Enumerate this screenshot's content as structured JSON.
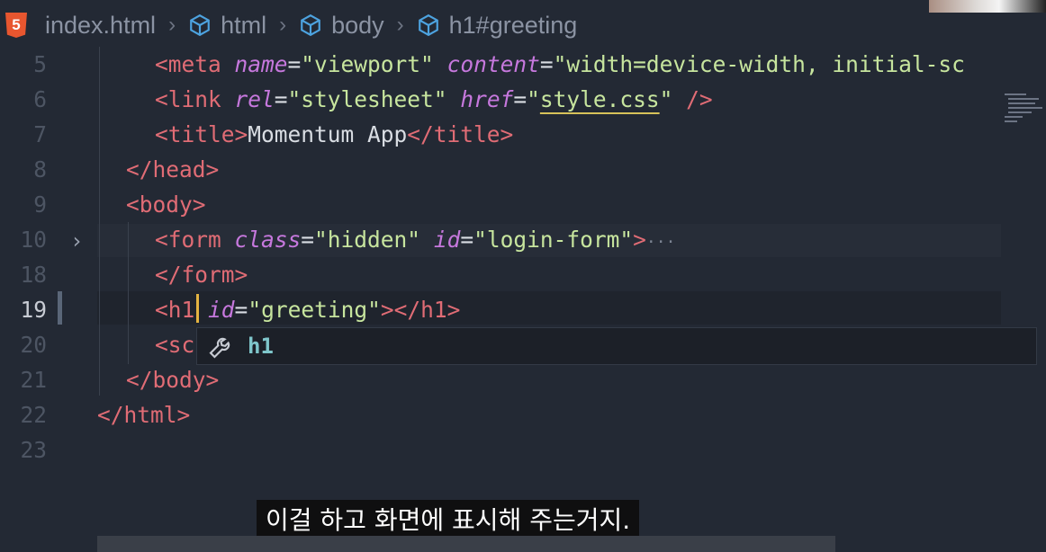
{
  "breadcrumb": {
    "file": "index.html",
    "items": [
      "html",
      "body",
      "h1#greeting"
    ],
    "file_icon_text": "5"
  },
  "lines": [
    {
      "num": "5",
      "code": [
        [
          "t",
          "<meta "
        ],
        [
          "a",
          "name"
        ],
        [
          "w",
          "="
        ],
        [
          "s",
          "\"viewport\""
        ],
        [
          "w",
          " "
        ],
        [
          "a",
          "content"
        ],
        [
          "w",
          "="
        ],
        [
          "s",
          "\"width=device-width, initial-sc"
        ]
      ]
    },
    {
      "num": "6",
      "code": [
        [
          "t",
          "<link "
        ],
        [
          "a",
          "rel"
        ],
        [
          "w",
          "="
        ],
        [
          "s",
          "\"stylesheet\""
        ],
        [
          "w",
          " "
        ],
        [
          "a",
          "href"
        ],
        [
          "w",
          "="
        ],
        [
          "s",
          "\""
        ],
        [
          "su",
          "style.css"
        ],
        [
          "s",
          "\""
        ],
        [
          "w",
          " "
        ],
        [
          "t",
          "/>"
        ]
      ]
    },
    {
      "num": "7",
      "code": [
        [
          "t",
          "<title>"
        ],
        [
          "w",
          "Momentum App"
        ],
        [
          "t",
          "</title>"
        ]
      ]
    },
    {
      "num": "8",
      "code": [
        [
          "t",
          "</head>"
        ]
      ]
    },
    {
      "num": "9",
      "code": [
        [
          "t",
          "<body>"
        ]
      ]
    },
    {
      "num": "10",
      "code": [
        [
          "t",
          "<form "
        ],
        [
          "a",
          "class"
        ],
        [
          "w",
          "="
        ],
        [
          "s",
          "\"hidden\""
        ],
        [
          "w",
          " "
        ],
        [
          "a",
          "id"
        ],
        [
          "w",
          "="
        ],
        [
          "s",
          "\"login-form\""
        ],
        [
          "t",
          ">"
        ],
        [
          "e",
          "···"
        ]
      ]
    },
    {
      "num": "18",
      "code": [
        [
          "t",
          "</form>"
        ]
      ]
    },
    {
      "num": "19",
      "code": [
        [
          "t",
          "<h1"
        ],
        [
          "w",
          " "
        ],
        [
          "a",
          "id"
        ],
        [
          "w",
          "="
        ],
        [
          "s",
          "\"greeting\""
        ],
        [
          "t",
          "></h1>"
        ]
      ]
    },
    {
      "num": "20",
      "code": [
        [
          "t",
          "<sc"
        ]
      ]
    },
    {
      "num": "21",
      "code": [
        [
          "t",
          "</body>"
        ]
      ]
    },
    {
      "num": "22",
      "code": [
        [
          "t",
          "</html>"
        ]
      ]
    },
    {
      "num": "23",
      "code": []
    }
  ],
  "suggestion": {
    "label": "h1",
    "icon": "wrench-icon"
  },
  "subtitle": "이걸 하고 화면에 표시해 주는거지."
}
